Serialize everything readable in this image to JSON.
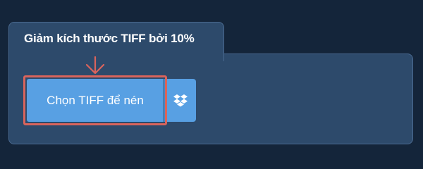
{
  "tab": {
    "title": "Giảm kích thước TIFF bởi 10%"
  },
  "upload": {
    "choose_label": "Chọn TIFF để nén",
    "dropbox_icon": "dropbox-icon"
  },
  "colors": {
    "background": "#14253a",
    "panel": "#2d4a6b",
    "button": "#58a0e3",
    "highlight": "#d9645c"
  }
}
